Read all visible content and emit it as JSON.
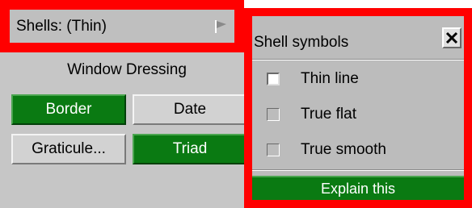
{
  "colors": {
    "highlight_red": "#ff0000",
    "button_green": "#0a7a12",
    "panel_grey": "#c6c6c6"
  },
  "header": {
    "label": "Shells: (Thin)",
    "icon": "flag-icon"
  },
  "window_dressing": {
    "title": "Window Dressing",
    "buttons": [
      {
        "label": "Border",
        "active": true
      },
      {
        "label": "Date",
        "active": false
      },
      {
        "label": "Graticule...",
        "active": false
      },
      {
        "label": "Triad",
        "active": true
      }
    ]
  },
  "popup": {
    "title": "Shell symbols",
    "close_icon": "close-icon",
    "options": [
      {
        "label": "Thin line",
        "checked_style": true
      },
      {
        "label": "True flat",
        "checked_style": false
      },
      {
        "label": "True smooth",
        "checked_style": false
      }
    ],
    "explain_label": "Explain this"
  }
}
